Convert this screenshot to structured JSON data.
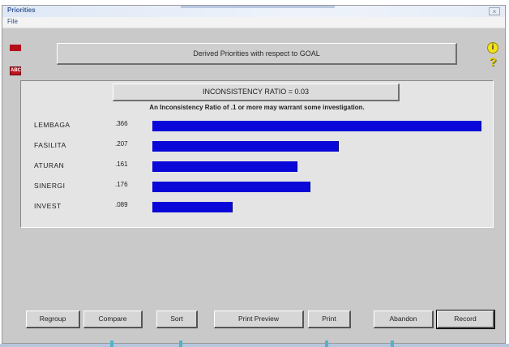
{
  "window": {
    "title": "Priorities",
    "close_glyph": "×"
  },
  "menu": {
    "file_label": "File"
  },
  "icons": {
    "info": "info-icon",
    "help": "help-icon",
    "abc_text": "ABC"
  },
  "header": {
    "title": "Derived Priorities with respect to GOAL"
  },
  "panel": {
    "inconsistency_label": "INCONSISTENCY RATIO = 0.03",
    "note": "An Inconsistency Ratio of .1 or more may warrant some investigation."
  },
  "chart_data": {
    "type": "bar",
    "categories": [
      "LEMBAGA",
      "FASILITA",
      "ATURAN",
      "SINERGI",
      "INVEST"
    ],
    "value_labels": [
      ".366",
      ".207",
      ".161",
      ".176",
      ".089"
    ],
    "values": [
      0.366,
      0.207,
      0.161,
      0.176,
      0.089
    ],
    "xlim": [
      0,
      0.366
    ],
    "bar_color": "#0a08d8"
  },
  "buttons": {
    "regroup": "Regroup",
    "compare": "Compare",
    "sort": "Sort",
    "print_preview": "Print Preview",
    "print": "Print",
    "abandon": "Abandon",
    "record": "Record"
  },
  "colors": {
    "window_bg": "#c9c9c9",
    "panel_bg": "#e4e4e4",
    "title_text": "#3b5c9a"
  }
}
